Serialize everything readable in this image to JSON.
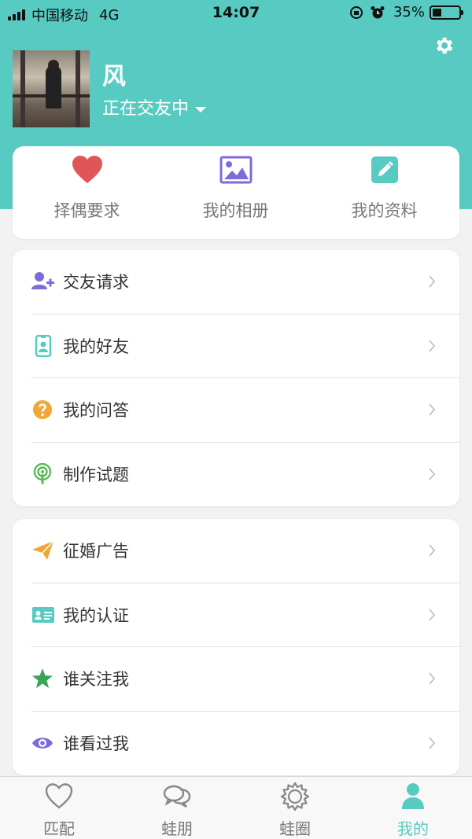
{
  "status_bar": {
    "carrier": "中国移动",
    "network": "4G",
    "time": "14:07",
    "battery": "35%",
    "battery_level": 0.35
  },
  "colors": {
    "primary": "#57cbc2",
    "heart": "#e05555",
    "purple": "#7f6ad9",
    "teal": "#57cbc2",
    "orange": "#f0a736",
    "green": "#5cb85c",
    "star": "#3aa655"
  },
  "profile": {
    "name": "风",
    "status": "正在交友中"
  },
  "quick_actions": [
    {
      "label": "择偶要求",
      "icon": "heart-icon"
    },
    {
      "label": "我的相册",
      "icon": "image-icon"
    },
    {
      "label": "我的资料",
      "icon": "edit-icon"
    }
  ],
  "menu_group1": [
    {
      "label": "交友请求",
      "icon": "user-add-icon"
    },
    {
      "label": "我的好友",
      "icon": "badge-icon"
    },
    {
      "label": "我的问答",
      "icon": "question-icon"
    },
    {
      "label": "制作试题",
      "icon": "podcast-icon"
    }
  ],
  "menu_group2": [
    {
      "label": "征婚广告",
      "icon": "paper-plane-icon"
    },
    {
      "label": "我的认证",
      "icon": "id-card-icon"
    },
    {
      "label": "谁关注我",
      "icon": "star-icon"
    },
    {
      "label": "谁看过我",
      "icon": "eye-icon"
    }
  ],
  "tabs": [
    {
      "label": "匹配",
      "icon": "heart-outline-icon"
    },
    {
      "label": "蛙朋",
      "icon": "chat-bubbles-icon"
    },
    {
      "label": "蛙圈",
      "icon": "sun-icon"
    },
    {
      "label": "我的",
      "icon": "user-icon",
      "active": true
    }
  ]
}
